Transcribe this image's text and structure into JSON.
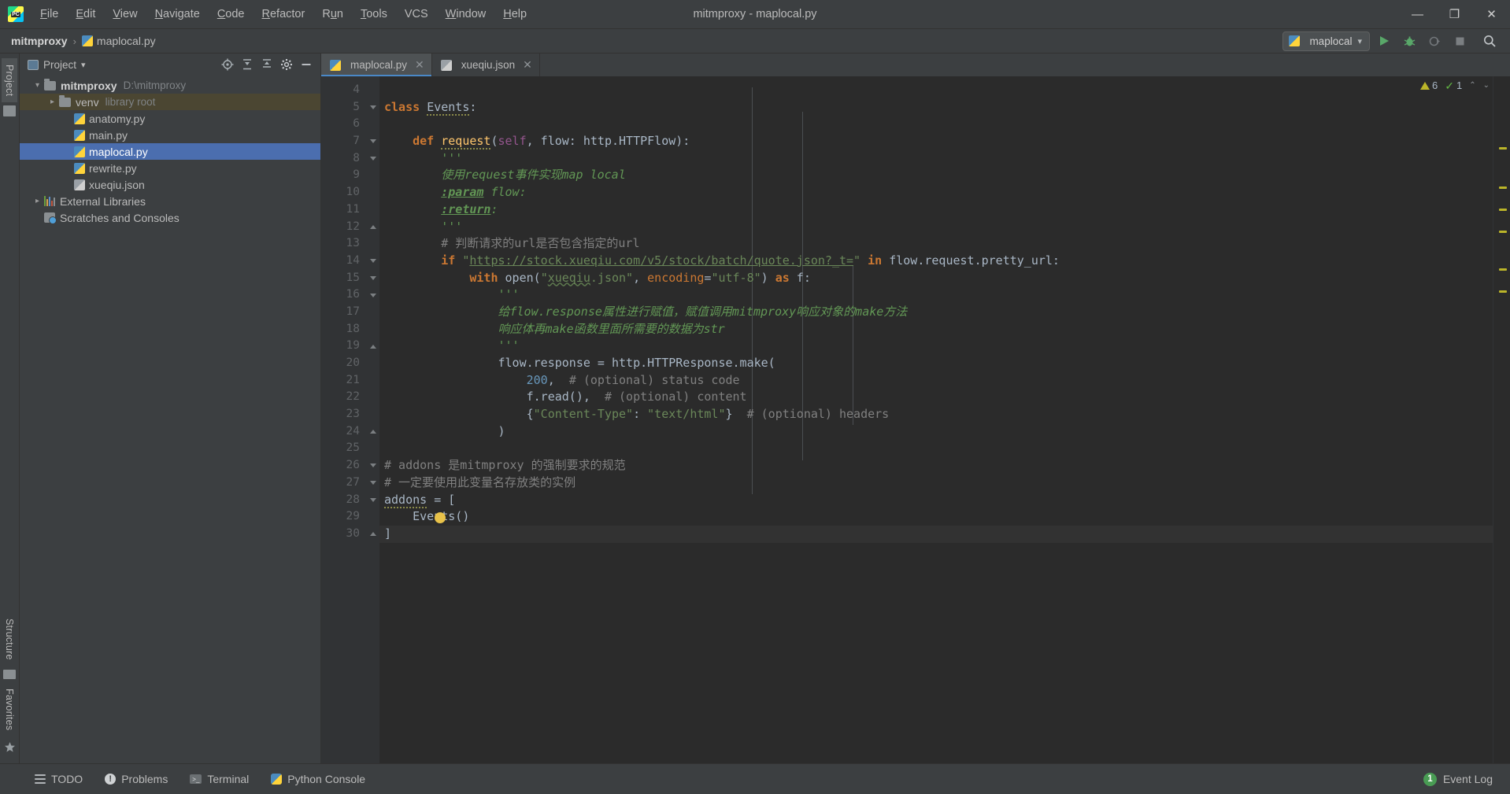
{
  "window": {
    "title": "mitmproxy - maplocal.py",
    "logo_text": "PC",
    "minimize": "—",
    "maximize": "❐",
    "close": "✕"
  },
  "menu": [
    {
      "label": "File"
    },
    {
      "label": "Edit"
    },
    {
      "label": "View"
    },
    {
      "label": "Navigate"
    },
    {
      "label": "Code"
    },
    {
      "label": "Refactor"
    },
    {
      "label": "Run"
    },
    {
      "label": "Tools"
    },
    {
      "label": "VCS"
    },
    {
      "label": "Window"
    },
    {
      "label": "Help"
    }
  ],
  "breadcrumb": {
    "project": "mitmproxy",
    "separator": "›",
    "file": "maplocal.py"
  },
  "toolbar": {
    "run_config": "maplocal",
    "dropdown_caret": "▾",
    "run_icon": "run-icon",
    "debug_icon": "debug-icon",
    "coverage_icon": "coverage-icon",
    "stop_icon": "stop-icon",
    "search_icon": "search-icon"
  },
  "rails": {
    "left_top": "Project",
    "left_bottom_structure": "Structure",
    "left_bottom_favorites": "Favorites"
  },
  "project_panel": {
    "title": "Project",
    "caret": "▾",
    "actions": [
      "locate-icon",
      "expand-all-icon",
      "collapse-all-icon",
      "settings-icon",
      "hide-icon"
    ],
    "tree": [
      {
        "label": "mitmproxy",
        "sub": "D:\\mitmproxy",
        "indent": 0,
        "arrow": "⌄",
        "icon": "folder",
        "bold": true,
        "state": "normal"
      },
      {
        "label": "venv",
        "sub": "library root",
        "indent": 1,
        "arrow": "›",
        "icon": "folder",
        "bold": false,
        "state": "library"
      },
      {
        "label": "anatomy.py",
        "sub": "",
        "indent": 2,
        "arrow": "",
        "icon": "python",
        "bold": false,
        "state": "normal"
      },
      {
        "label": "main.py",
        "sub": "",
        "indent": 2,
        "arrow": "",
        "icon": "python",
        "bold": false,
        "state": "normal"
      },
      {
        "label": "maplocal.py",
        "sub": "",
        "indent": 2,
        "arrow": "",
        "icon": "python",
        "bold": false,
        "state": "selected"
      },
      {
        "label": "rewrite.py",
        "sub": "",
        "indent": 2,
        "arrow": "",
        "icon": "python",
        "bold": false,
        "state": "normal"
      },
      {
        "label": "xueqiu.json",
        "sub": "",
        "indent": 2,
        "arrow": "",
        "icon": "json",
        "bold": false,
        "state": "normal"
      },
      {
        "label": "External Libraries",
        "sub": "",
        "indent": 0,
        "arrow": "›",
        "icon": "libraries",
        "bold": false,
        "state": "normal"
      },
      {
        "label": "Scratches and Consoles",
        "sub": "",
        "indent": 0,
        "arrow": "",
        "icon": "scratches",
        "bold": false,
        "state": "normal"
      }
    ]
  },
  "editor": {
    "tabs": [
      {
        "label": "maplocal.py",
        "icon": "python",
        "active": true,
        "close": "✕"
      },
      {
        "label": "xueqiu.json",
        "icon": "json",
        "active": false,
        "close": "✕"
      }
    ],
    "first_line_number": 4,
    "line_numbers": [
      4,
      5,
      6,
      7,
      8,
      9,
      10,
      11,
      12,
      13,
      14,
      15,
      16,
      17,
      18,
      19,
      20,
      21,
      22,
      23,
      24,
      25,
      26,
      27,
      28,
      29,
      30
    ],
    "inspection": {
      "warning_count": "6",
      "ok_count": "1",
      "warning_icon": "warning-triangle-icon",
      "ok_icon": "checkmark-icon",
      "up_caret": "⌃",
      "down_caret": "⌄"
    },
    "code_lines": [
      "",
      "class Events:",
      "",
      "    def request(self, flow: http.HTTPFlow):",
      "        '''",
      "        使用request事件实现map local",
      "        :param flow:",
      "        :return:",
      "        '''",
      "        # 判断请求的url是否包含指定的url",
      "        if \"https://stock.xueqiu.com/v5/stock/batch/quote.json?_t=\" in flow.request.pretty_url:",
      "            with open(\"xueqiu.json\", encoding=\"utf-8\") as f:",
      "                '''",
      "                给flow.response属性进行赋值，赋值调用mitmproxy响应对象的make方法",
      "                响应体再make函数里面所需要的数据为str",
      "                '''",
      "                flow.response = http.HTTPResponse.make(",
      "                    200,  # (optional) status code",
      "                    f.read(),  # (optional) content",
      "                    {\"Content-Type\": \"text/html\"}  # (optional) headers",
      "                )",
      "",
      "# addons 是mitmproxy 的强制要求的规范",
      "# 一定要使用此变量名存放类的实例",
      "addons = [",
      "    Events()",
      "]"
    ]
  },
  "status_bar": {
    "items": [
      {
        "label": "TODO",
        "icon": "todo-list-icon"
      },
      {
        "label": "Problems",
        "icon": "problems-icon"
      },
      {
        "label": "Terminal",
        "icon": "terminal-icon"
      },
      {
        "label": "Python Console",
        "icon": "python-console-icon"
      }
    ],
    "event_log": {
      "label": "Event Log",
      "count": "1"
    }
  },
  "colors": {
    "accent_blue": "#4b6eaf",
    "editor_bg": "#2b2b2b",
    "panel_bg": "#3c3f41",
    "gutter_bg": "#313335",
    "keyword": "#cc7832",
    "string": "#6a8759",
    "docstring": "#629755",
    "number": "#6897bb",
    "function": "#ffc66d",
    "comment": "#808080",
    "text": "#a9b7c6",
    "library_row": "#4b4632",
    "green_badge": "#499c54"
  }
}
